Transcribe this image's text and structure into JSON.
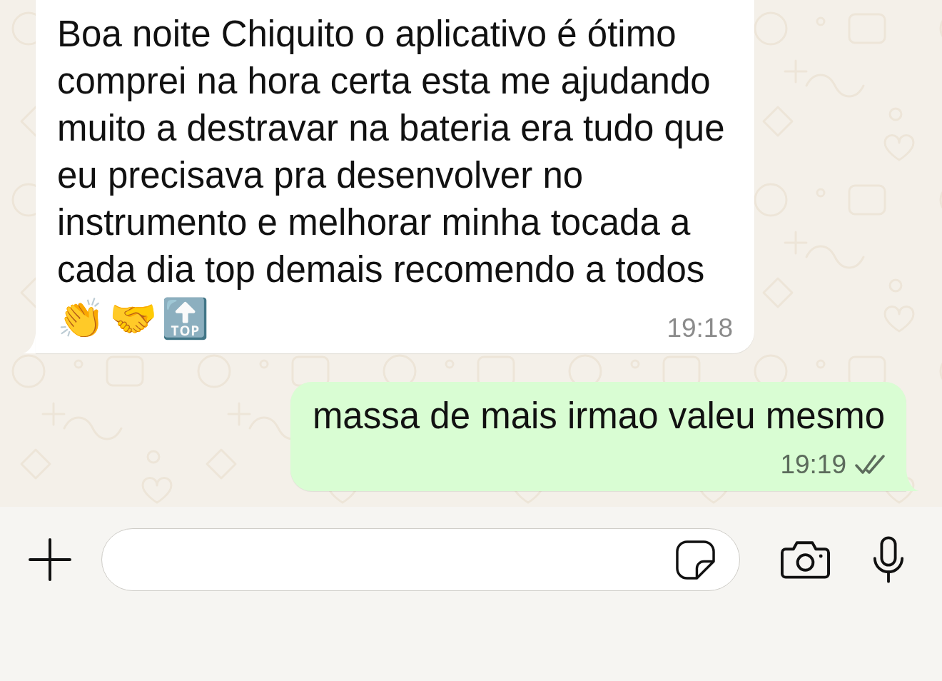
{
  "messages": [
    {
      "kind": "incoming",
      "text": "Boa noite Chiquito o aplicativo é ótimo\ncomprei na hora certa esta me ajudando\nmuito a destravar na bateria era tudo que\neu precisava pra desenvolver no\ninstrumento e melhorar minha tocada a\ncada dia top demais recomendo a todos",
      "emojis": [
        "👏",
        "🤝",
        "🔝"
      ],
      "time": "19:18"
    },
    {
      "kind": "outgoing",
      "text": "massa de mais irmao valeu mesmo",
      "time": "19:19",
      "read": false
    }
  ]
}
